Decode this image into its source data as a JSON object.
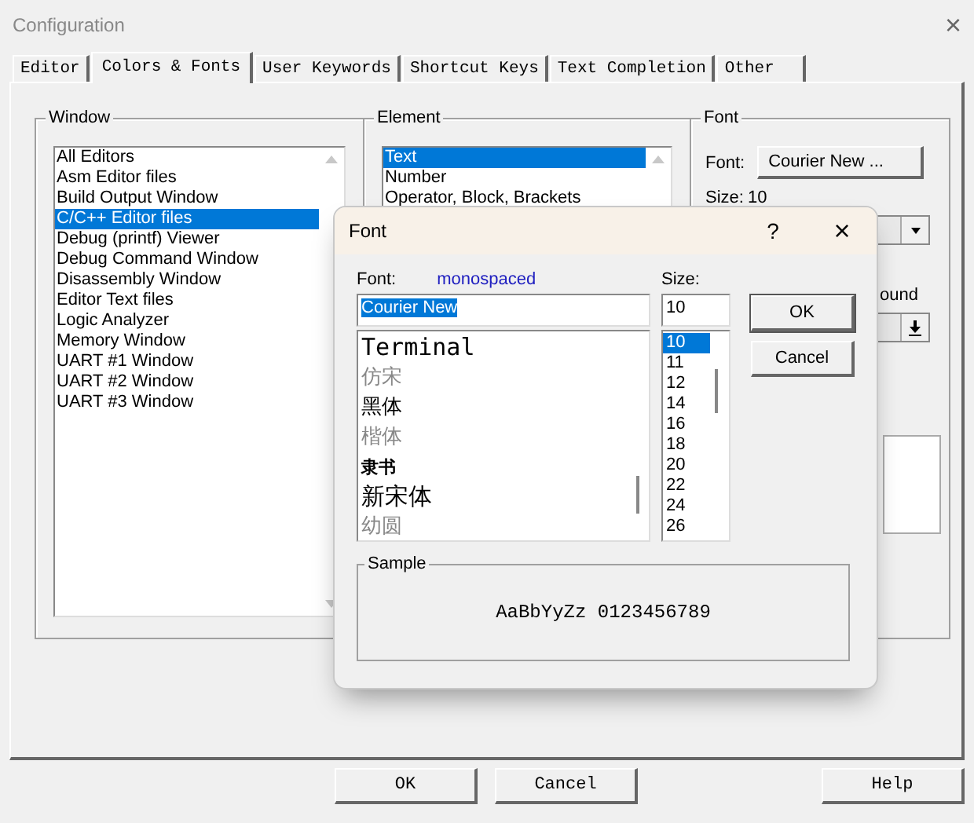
{
  "window": {
    "title": "Configuration",
    "close": "×"
  },
  "tabs": [
    {
      "label": "Editor",
      "selected": false
    },
    {
      "label": "Colors & Fonts",
      "selected": true
    },
    {
      "label": "User Keywords",
      "selected": false
    },
    {
      "label": "Shortcut Keys",
      "selected": false
    },
    {
      "label": "Text Completion",
      "selected": false
    },
    {
      "label": "Other",
      "selected": false
    }
  ],
  "window_group": {
    "title": "Window",
    "items": [
      {
        "label": "All Editors",
        "selected": false
      },
      {
        "label": "Asm Editor files",
        "selected": false
      },
      {
        "label": "Build Output Window",
        "selected": false
      },
      {
        "label": "C/C++ Editor files",
        "selected": true
      },
      {
        "label": "Debug (printf) Viewer",
        "selected": false
      },
      {
        "label": "Debug Command Window",
        "selected": false
      },
      {
        "label": "Disassembly Window",
        "selected": false
      },
      {
        "label": "Editor Text files",
        "selected": false
      },
      {
        "label": "Logic Analyzer",
        "selected": false
      },
      {
        "label": "Memory Window",
        "selected": false
      },
      {
        "label": "UART #1 Window",
        "selected": false
      },
      {
        "label": "UART #2 Window",
        "selected": false
      },
      {
        "label": "UART #3 Window",
        "selected": false
      }
    ]
  },
  "element_group": {
    "title": "Element",
    "items": [
      {
        "label": "Text",
        "selected": true
      },
      {
        "label": "Number",
        "selected": false
      },
      {
        "label": "Operator, Block, Brackets",
        "selected": false
      }
    ]
  },
  "font_group": {
    "title": "Font",
    "font_label": "Font:",
    "font_button": "Courier New ...",
    "size_label": "Size:",
    "size_value": "10",
    "background_label": "ound"
  },
  "font_dialog": {
    "title": "Font",
    "help": "?",
    "close": "×",
    "font_label": "Font:",
    "font_hint": "monospaced",
    "font_value": "Courier New",
    "fonts": [
      {
        "label": "Terminal",
        "greyed": false,
        "kind": "mono"
      },
      {
        "label": "仿宋",
        "greyed": true,
        "kind": "plain"
      },
      {
        "label": "黑体",
        "greyed": false,
        "kind": "plain"
      },
      {
        "label": "楷体",
        "greyed": true,
        "kind": "plain"
      },
      {
        "label": "隶书",
        "greyed": false,
        "kind": "bold"
      },
      {
        "label": "新宋体",
        "greyed": false,
        "kind": "large"
      },
      {
        "label": "幼圆",
        "greyed": true,
        "kind": "plain"
      }
    ],
    "size_label": "Size:",
    "size_value": "10",
    "sizes": [
      {
        "label": "10",
        "selected": true
      },
      {
        "label": "11",
        "selected": false
      },
      {
        "label": "12",
        "selected": false
      },
      {
        "label": "14",
        "selected": false
      },
      {
        "label": "16",
        "selected": false
      },
      {
        "label": "18",
        "selected": false
      },
      {
        "label": "20",
        "selected": false
      },
      {
        "label": "22",
        "selected": false
      },
      {
        "label": "24",
        "selected": false
      },
      {
        "label": "26",
        "selected": false
      }
    ],
    "ok": "OK",
    "cancel": "Cancel",
    "sample_title": "Sample",
    "sample_text": "AaBbYyZz 0123456789"
  },
  "buttons": [
    "OK",
    "Cancel",
    "Help"
  ]
}
